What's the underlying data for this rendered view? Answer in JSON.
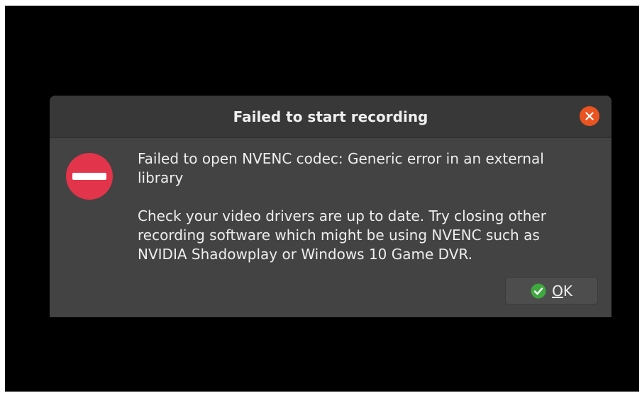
{
  "dialog": {
    "title": "Failed to start recording",
    "close_icon": "close-icon",
    "error_icon": "error-icon",
    "message_primary": "Failed to open NVENC codec: Generic error in an external library",
    "message_secondary": "Check your video drivers are up to date. Try closing other recording software which might be using NVENC such as NVIDIA Shadowplay or Windows 10 Game DVR.",
    "ok_button": {
      "mnemonic": "O",
      "rest": "K",
      "icon": "checkmark-icon"
    }
  },
  "colors": {
    "background": "#000000",
    "dialog": "#434343",
    "titlebar": "#383838",
    "close": "#e95420",
    "error": "#e2344a",
    "ok_check": "#3fa83f"
  }
}
